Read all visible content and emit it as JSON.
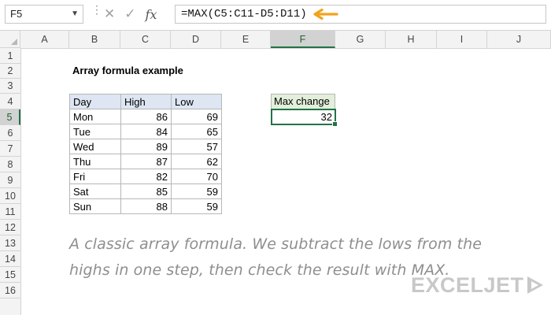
{
  "formula_bar": {
    "name_box": "F5",
    "name_box_caret": "▼",
    "formula": "=MAX(C5:C11-D5:D11)",
    "dots": "⋮",
    "cancel_symbol": "✕",
    "enter_symbol": "✓",
    "fx_label": "fx",
    "arrow_color": "#f2a21d"
  },
  "columns": [
    "A",
    "B",
    "C",
    "D",
    "E",
    "F",
    "G",
    "H",
    "I",
    "J"
  ],
  "rows": [
    "1",
    "2",
    "3",
    "4",
    "5",
    "6",
    "7",
    "8",
    "9",
    "10",
    "11",
    "12",
    "13",
    "14",
    "15",
    "16"
  ],
  "selected_column": "F",
  "selected_row": "5",
  "sheet": {
    "title": "Array formula example",
    "table": {
      "headers": [
        "Day",
        "High",
        "Low"
      ],
      "rows": [
        [
          "Mon",
          "86",
          "69"
        ],
        [
          "Tue",
          "84",
          "65"
        ],
        [
          "Wed",
          "89",
          "57"
        ],
        [
          "Thu",
          "87",
          "62"
        ],
        [
          "Fri",
          "82",
          "70"
        ],
        [
          "Sat",
          "85",
          "59"
        ],
        [
          "Sun",
          "88",
          "59"
        ]
      ]
    },
    "max_change_label": "Max change",
    "max_change_value": "32",
    "note": "A classic array formula. We subtract the lows from the highs in one step, then check the result with MAX."
  },
  "logo": {
    "text": "EXCELJET",
    "color": "#c8c8c8"
  },
  "colors": {
    "selection": "#217346",
    "table_header_fill": "#dde6f2",
    "label_fill": "#e2efda"
  }
}
